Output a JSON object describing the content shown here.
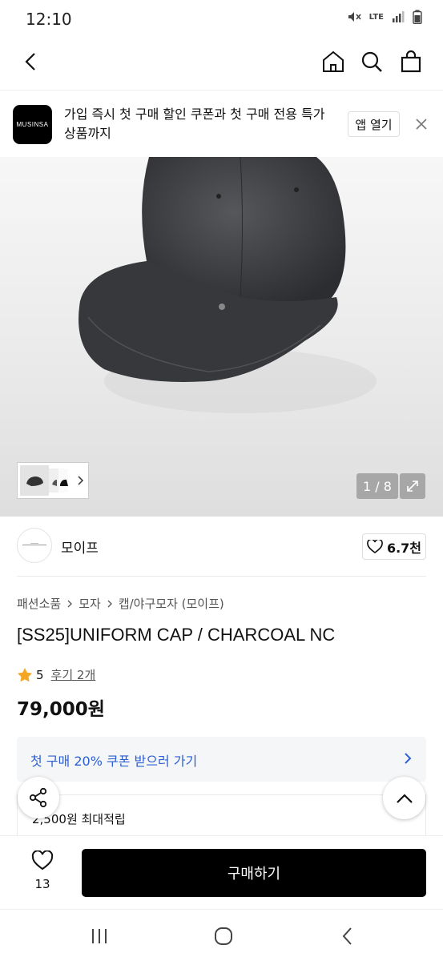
{
  "status": {
    "time": "12:10",
    "net": "LTE"
  },
  "header": {
    "back_icon": "chevron-left-icon",
    "home_icon": "home-icon",
    "search_icon": "search-icon",
    "cart_icon": "shopping-bag-icon"
  },
  "promo": {
    "logo_text": "MUSINSA",
    "message": "가입 즉시 첫 구매 할인 쿠폰과 첫 구매 전용 특가 상품까지",
    "open_label": "앱 열기"
  },
  "gallery": {
    "counter": "1 / 8",
    "current": 1,
    "total": 8
  },
  "brand": {
    "name": "모이프",
    "likes": "6.7천"
  },
  "breadcrumb": [
    "패션소품",
    "모자",
    "캡/야구모자 (모이프)"
  ],
  "product": {
    "title": "[SS25]UNIFORM CAP / CHARCOAL NC",
    "rating": "5",
    "reviews": "후기 2개",
    "price": "79,000원"
  },
  "coupon": {
    "label": "첫 구매 20% 쿠폰 받으러 가기"
  },
  "points": {
    "label": "2,500원 최대적립"
  },
  "bottom": {
    "wish_count": "13",
    "buy_label": "구매하기"
  },
  "colors": {
    "coupon_text": "#2c5ed3",
    "star": "#f5a623",
    "buy_bg": "#000000"
  }
}
